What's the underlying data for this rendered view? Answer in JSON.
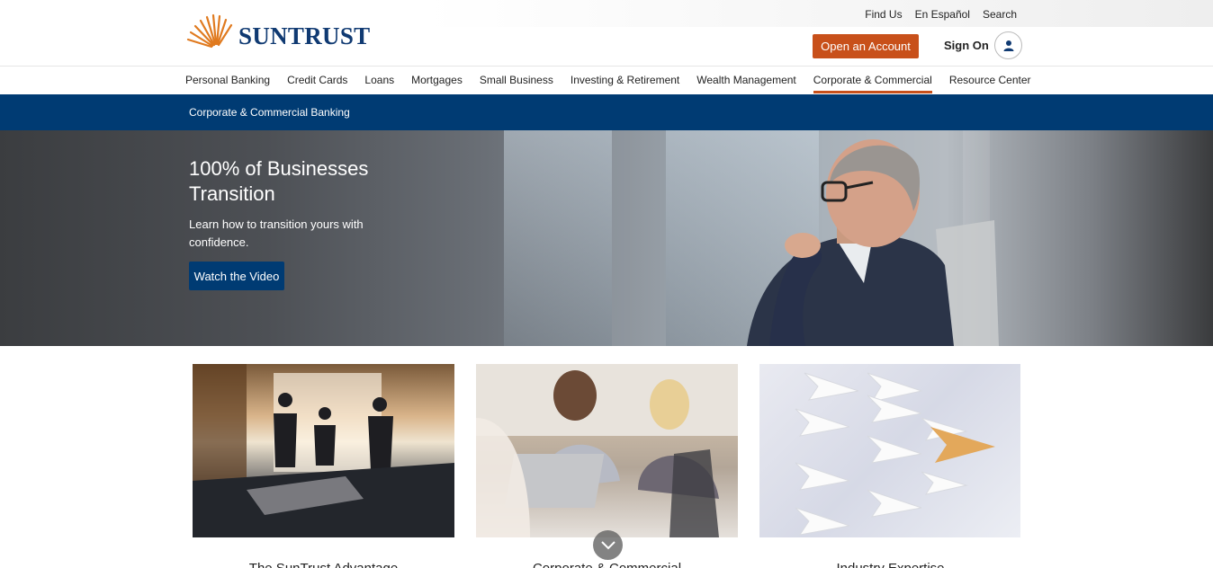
{
  "utility": {
    "links": [
      "Find Us",
      "En Español",
      "Search"
    ]
  },
  "header": {
    "brand": "SUNTRUST",
    "open_account": "Open an Account",
    "sign_on": "Sign On"
  },
  "nav": {
    "items": [
      "Personal Banking",
      "Credit Cards",
      "Loans",
      "Mortgages",
      "Small Business",
      "Investing & Retirement",
      "Wealth Management",
      "Corporate & Commercial",
      "Resource Center"
    ],
    "active": "Corporate & Commercial"
  },
  "subnav": {
    "label": "Corporate & Commercial Banking"
  },
  "hero": {
    "title": "100% of Businesses Transition",
    "subtitle": "Learn how to transition yours with confidence.",
    "cta": "Watch the Video"
  },
  "cards": [
    {
      "title": "The SunTrust Advantage"
    },
    {
      "title": "Corporate & Commercial"
    },
    {
      "title": "Industry Expertise"
    }
  ],
  "colors": {
    "brand_navy": "#003b73",
    "brand_orange": "#c8501a"
  }
}
